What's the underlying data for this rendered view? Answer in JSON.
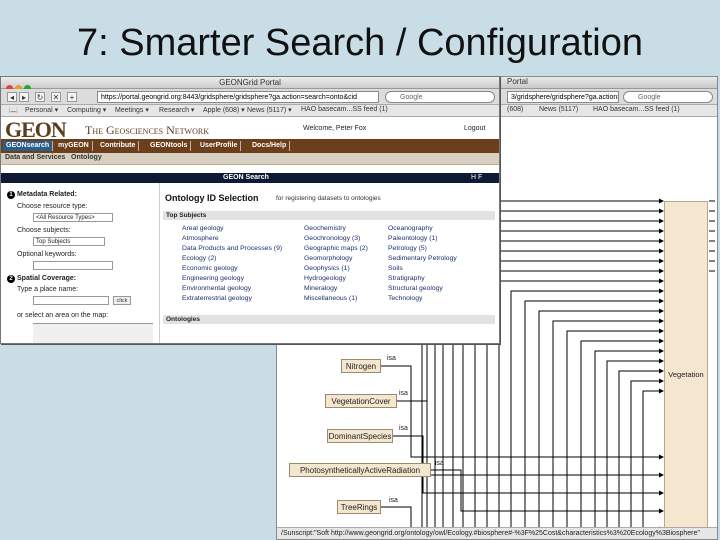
{
  "slide": {
    "title": "7: Smarter Search / Configuration"
  },
  "back_window": {
    "title": "Portal",
    "url": "3/gridsphere/gridsphere?ga.action=...",
    "search_placeholder": "Google",
    "bookmarks": [
      "(608)",
      "News (5117)",
      "HAO basecam...SS feed (1)"
    ],
    "status": "/Sunscript:\"Soft http://www.geongrid.org/ontology/owl/Ecology.#biosphere#-%3F%25Cost&characteristics%3%20Ecology%3Biosphere\""
  },
  "diagram": {
    "big_node": "Vegetation",
    "nodes": [
      "Nitrogen",
      "VegetationCover",
      "DominantSpecies",
      "PhotosyntheticallyActiveRadiation",
      "TreeRings"
    ],
    "edge_label": "isa"
  },
  "front_window": {
    "title": "GEONGrid Portal",
    "url": "https://portal.geongrid.org:8443/gridsphere/gridsphere?ga.action=search=onto&cid",
    "search_placeholder": "Google",
    "bookmarks": [
      "Personal ▾",
      "Computing ▾",
      "Meetings ▾",
      "Research ▾",
      "Apple (608) ▾",
      "News (5117) ▾",
      "HAO basecam...SS feed (1)"
    ]
  },
  "geon": {
    "logo": "GEON",
    "tagline": "The Geosciences Network",
    "welcome": "Welcome, Peter Fox",
    "logout": "Logout",
    "tabs": [
      "GEONsearch",
      "myGEON",
      "Contribute",
      "GEONtools",
      "UserProfile",
      "Docs/Help"
    ],
    "subtabs": [
      "Data and Services",
      "Ontology"
    ],
    "search_bar_title": "GEON Search",
    "search_bar_icons": "H F",
    "left": {
      "metadata_heading": "Metadata Related:",
      "resource_label": "Choose resource type:",
      "resource_value": "<All Resource Types>",
      "subjects_label": "Choose subjects:",
      "subjects_value": "Top Subjects",
      "keywords_label": "Optional keywords:",
      "spatial_heading": "Spatial Coverage:",
      "place_label": "Type a place name:",
      "place_button": "click",
      "area_label": "or select an area on the map:"
    },
    "right": {
      "title": "Ontology ID Selection",
      "subtitle": "for registering datasets to ontologies",
      "top_subjects": "Top Subjects",
      "col1": [
        "Areal geology",
        "Atmosphere",
        "Data Products and Processes (9)",
        "Ecology (2)",
        "Economic geology",
        "Engineering geology",
        "Environmental geology",
        "Extraterrestrial geology"
      ],
      "col2": [
        "Geochemistry",
        "Geochronology (3)",
        "Geographic maps (2)",
        "Geomorphology",
        "Geophysics (1)",
        "Hydrogeology",
        "Mineralogy",
        "Miscellaneous (1)"
      ],
      "col3": [
        "Oceanography",
        "Paleontology (1)",
        "Petrology (5)",
        "Sedimentary Petrology",
        "Soils",
        "Stratigraphy",
        "Structural geology",
        "Technology"
      ],
      "ontologies": "Ontologies"
    }
  }
}
